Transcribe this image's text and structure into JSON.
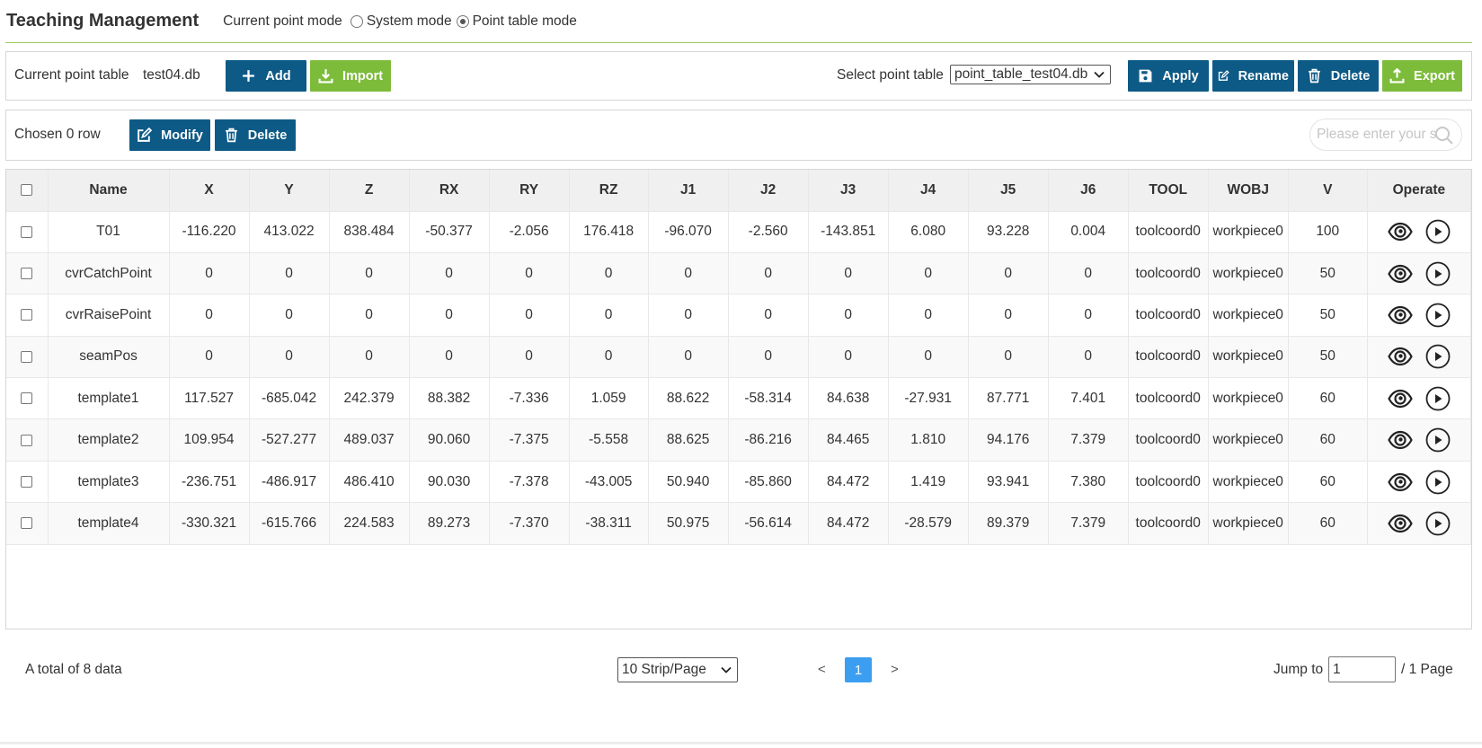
{
  "header": {
    "title": "Teaching Management",
    "mode_label": "Current point mode",
    "modes": [
      "System mode",
      "Point table mode"
    ],
    "selected_mode": "Point table mode"
  },
  "toolbar1": {
    "current_label": "Current point table",
    "current_value": "test04.db",
    "add_label": "Add",
    "import_label": "Import",
    "select_label": "Select point table",
    "select_value": "point_table_test04.db",
    "apply_label": "Apply",
    "rename_label": "Rename",
    "delete_label": "Delete",
    "export_label": "Export"
  },
  "toolbar2": {
    "chosen_label": "Chosen 0 row",
    "modify_label": "Modify",
    "delete_label": "Delete",
    "search_placeholder": "Please enter your s"
  },
  "table": {
    "columns": [
      "Name",
      "X",
      "Y",
      "Z",
      "RX",
      "RY",
      "RZ",
      "J1",
      "J2",
      "J3",
      "J4",
      "J5",
      "J6",
      "TOOL",
      "WOBJ",
      "V",
      "Operate"
    ],
    "rows": [
      [
        "T01",
        "-116.220",
        "413.022",
        "838.484",
        "-50.377",
        "-2.056",
        "176.418",
        "-96.070",
        "-2.560",
        "-143.851",
        "6.080",
        "93.228",
        "0.004",
        "toolcoord0",
        "workpiece0",
        "100"
      ],
      [
        "cvrCatchPoint",
        "0",
        "0",
        "0",
        "0",
        "0",
        "0",
        "0",
        "0",
        "0",
        "0",
        "0",
        "0",
        "toolcoord0",
        "workpiece0",
        "50"
      ],
      [
        "cvrRaisePoint",
        "0",
        "0",
        "0",
        "0",
        "0",
        "0",
        "0",
        "0",
        "0",
        "0",
        "0",
        "0",
        "toolcoord0",
        "workpiece0",
        "50"
      ],
      [
        "seamPos",
        "0",
        "0",
        "0",
        "0",
        "0",
        "0",
        "0",
        "0",
        "0",
        "0",
        "0",
        "0",
        "toolcoord0",
        "workpiece0",
        "50"
      ],
      [
        "template1",
        "117.527",
        "-685.042",
        "242.379",
        "88.382",
        "-7.336",
        "1.059",
        "88.622",
        "-58.314",
        "84.638",
        "-27.931",
        "87.771",
        "7.401",
        "toolcoord0",
        "workpiece0",
        "60"
      ],
      [
        "template2",
        "109.954",
        "-527.277",
        "489.037",
        "90.060",
        "-7.375",
        "-5.558",
        "88.625",
        "-86.216",
        "84.465",
        "1.810",
        "94.176",
        "7.379",
        "toolcoord0",
        "workpiece0",
        "60"
      ],
      [
        "template3",
        "-236.751",
        "-486.917",
        "486.410",
        "90.030",
        "-7.378",
        "-43.005",
        "50.940",
        "-85.860",
        "84.472",
        "1.419",
        "93.941",
        "7.380",
        "toolcoord0",
        "workpiece0",
        "60"
      ],
      [
        "template4",
        "-330.321",
        "-615.766",
        "224.583",
        "89.273",
        "-7.370",
        "-38.311",
        "50.975",
        "-56.614",
        "84.472",
        "-28.579",
        "89.379",
        "7.379",
        "toolcoord0",
        "workpiece0",
        "60"
      ]
    ],
    "row_icons": [
      "eye-icon",
      "play-icon"
    ]
  },
  "footer": {
    "total_text": "A total of 8 data",
    "page_size_value": "10 Strip/Page",
    "prev_label": "<",
    "current_page": "1",
    "next_label": ">",
    "jump_label": "Jump to",
    "jump_value": "1",
    "page_suffix": "/ 1 Page"
  },
  "colors": {
    "primary_blue": "#0d5a86",
    "primary_green": "#7cbc3a",
    "active_page": "#3c9ef0",
    "header_underline": "#9acd5a"
  }
}
